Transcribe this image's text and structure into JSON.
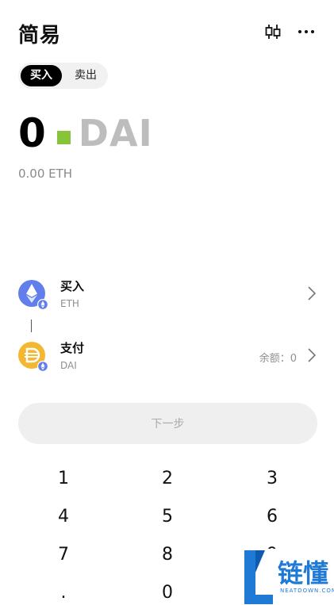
{
  "header": {
    "title": "简易",
    "icons": [
      "candlestick-chart-icon",
      "more-icon"
    ]
  },
  "mode_tabs": [
    {
      "label": "买入",
      "active": true
    },
    {
      "label": "卖出",
      "active": false
    }
  ],
  "amount": {
    "value": "0",
    "unit": "DAI",
    "equivalent": "0.00 ETH"
  },
  "buy_asset": {
    "action": "买入",
    "symbol": "ETH"
  },
  "pay_asset": {
    "action": "支付",
    "symbol": "DAI",
    "balance": "余额：0"
  },
  "next_button": "下一步",
  "keypad": {
    "keys": [
      "1",
      "2",
      "3",
      "4",
      "5",
      "6",
      "7",
      "8",
      "9",
      ".",
      "0",
      ""
    ]
  },
  "watermark": {
    "text": "链懂",
    "sub": "NEATDOWN.COM"
  },
  "colors": {
    "caret": "#88c43a",
    "eth": "#627eea",
    "dai": "#f4b731",
    "watermark": "#1f7ad6"
  }
}
